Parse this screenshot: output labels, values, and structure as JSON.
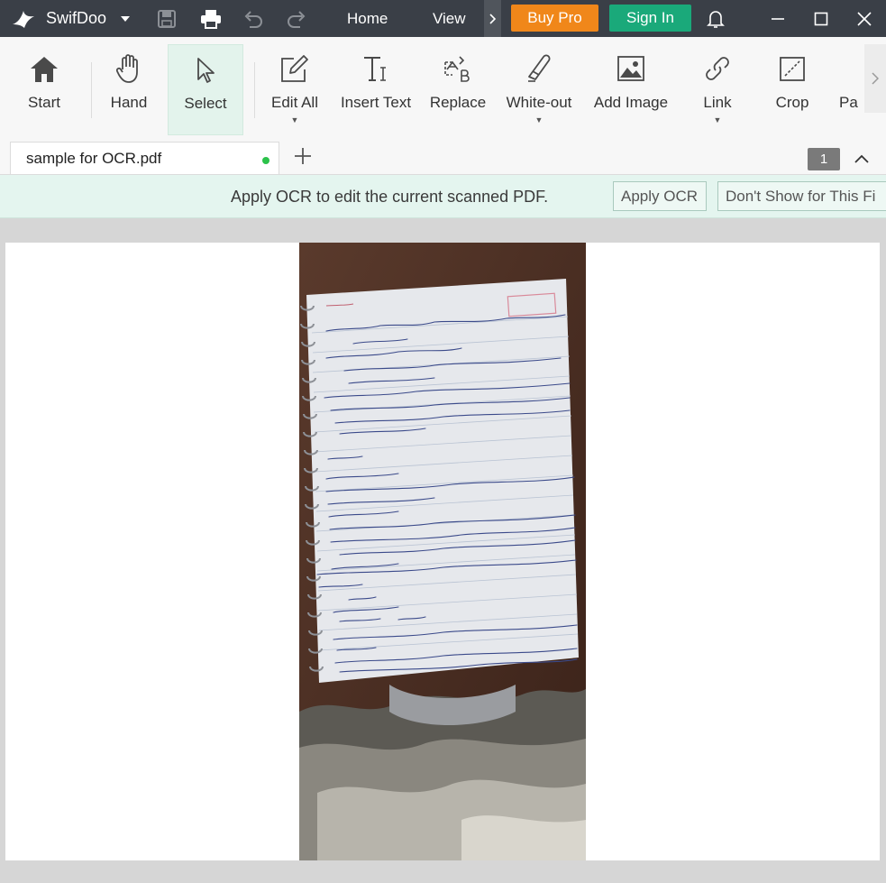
{
  "titlebar": {
    "app_name": "SwifDoo",
    "menu": {
      "home": "Home",
      "view": "View"
    },
    "buy_pro": "Buy Pro",
    "sign_in": "Sign In"
  },
  "toolbar": {
    "tools": {
      "start": "Start",
      "hand": "Hand",
      "select": "Select",
      "edit_all": "Edit All",
      "insert_text": "Insert Text",
      "replace": "Replace",
      "white_out": "White-out",
      "add_image": "Add Image",
      "link": "Link",
      "crop": "Crop",
      "page": "Pa"
    }
  },
  "tabs": {
    "active": "sample for OCR.pdf",
    "page_number": "1"
  },
  "ocr": {
    "message": "Apply OCR to edit the current scanned PDF.",
    "apply_button": "Apply OCR",
    "dont_show_button": "Don't Show for This Fi"
  },
  "document": {
    "content": "photo of handwritten notebook page"
  },
  "colors": {
    "titlebar": "#3a3f47",
    "buy_pro": "#f0871a",
    "sign_in": "#1aa97a",
    "ocr_bar": "#e4f5ef",
    "selected_tool": "#e3f3ec",
    "modified_dot": "#2bc24a"
  }
}
